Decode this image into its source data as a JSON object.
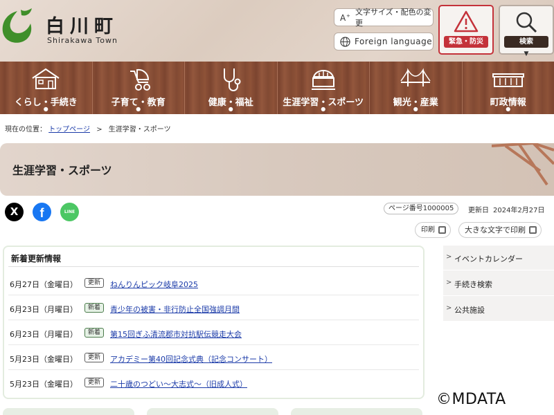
{
  "header": {
    "town_name": "白川町",
    "town_name_en": "Shirakawa Town",
    "text_size_button": "文字サイズ・配色の変更",
    "language_button": "Foreign language",
    "emergency_label": "緊急・防災",
    "search_label": "検索",
    "colors": {
      "emergency": "#c4323a",
      "search": "#3a2a22",
      "logo": "#3f8f2a"
    }
  },
  "nav": {
    "items": [
      {
        "label": "くらし・手続き",
        "icon": "house-icon"
      },
      {
        "label": "子育て・教育",
        "icon": "stroller-icon"
      },
      {
        "label": "健康・福祉",
        "icon": "stethoscope-icon"
      },
      {
        "label": "生涯学習・スポーツ",
        "icon": "building-icon"
      },
      {
        "label": "観光・産業",
        "icon": "bridge-icon"
      },
      {
        "label": "町政情報",
        "icon": "town-hall-icon"
      }
    ],
    "dot": "●"
  },
  "breadcrumb": {
    "prefix": "現在の位置：",
    "home": "トップページ",
    "separator": ">",
    "current": "生涯学習・スポーツ"
  },
  "page": {
    "title": "生涯学習・スポーツ",
    "page_number": "ページ番号1000005",
    "updated_label": "更新日",
    "updated_date": "2024年2月27日",
    "print_label": "印刷",
    "print_large_label": "大きな文字で印刷"
  },
  "social": {
    "x": "X",
    "facebook": "f",
    "line": "LINE"
  },
  "news": {
    "heading": "新着更新情報",
    "items": [
      {
        "date": "6月27日（金曜日）",
        "tag": "更新",
        "title": "ねんりんピック岐阜2025"
      },
      {
        "date": "6月23日（月曜日）",
        "tag": "新着",
        "title": "青少年の被害・非行防止全国強調月間"
      },
      {
        "date": "6月23日（月曜日）",
        "tag": "新着",
        "title": "第15回ぎふ清流郡市対抗駅伝競走大会"
      },
      {
        "date": "5月23日（金曜日）",
        "tag": "更新",
        "title": "アカデミー第40回記念式典（記念コンサート）"
      },
      {
        "date": "5月23日（金曜日）",
        "tag": "更新",
        "title": "二十歳のつどい～大志式～（旧成人式）"
      }
    ]
  },
  "side_menu": {
    "items": [
      {
        "label": "イベントカレンダー"
      },
      {
        "label": "手続き検索"
      },
      {
        "label": "公共施設"
      }
    ],
    "arrow": ">"
  },
  "watermark": "©MDATA"
}
